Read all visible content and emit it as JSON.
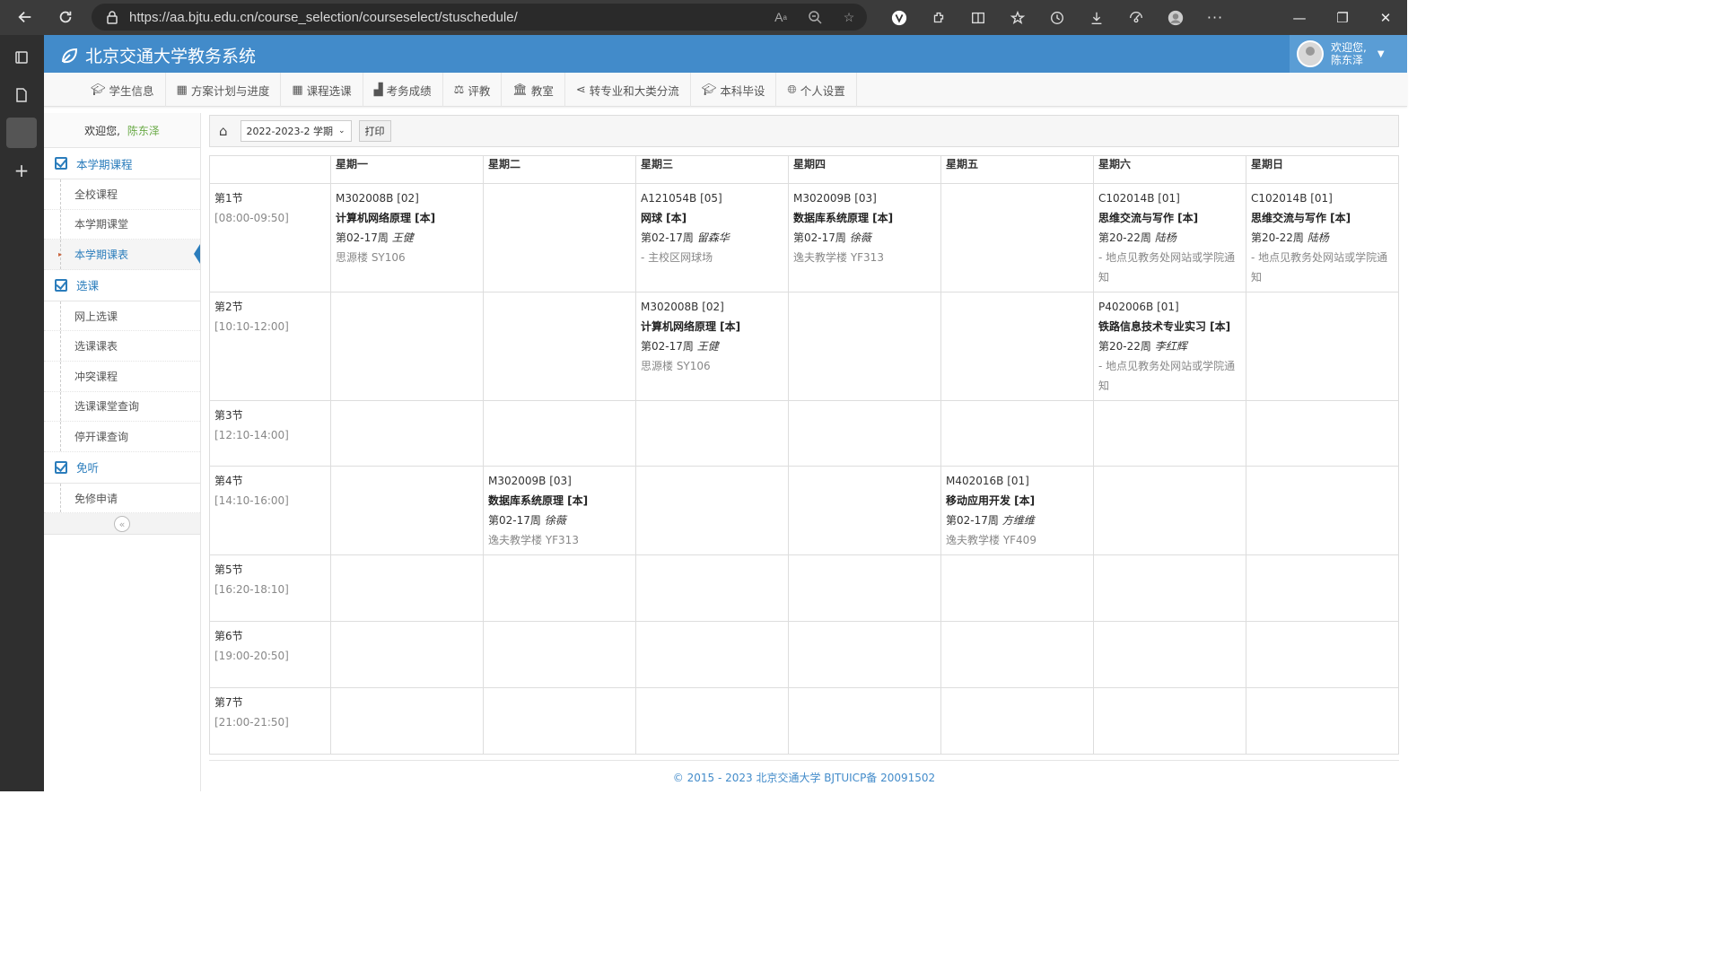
{
  "browser": {
    "url": "https://aa.bjtu.edu.cn/course_selection/courseselect/stuschedule/"
  },
  "app": {
    "title": "北京交通大学教务系统",
    "user_greeting": "欢迎您,",
    "user_name": "陈东泽"
  },
  "top_nav": [
    {
      "icon": "graduation-cap-icon",
      "label": "学生信息"
    },
    {
      "icon": "calendar-icon",
      "label": "方案计划与进度"
    },
    {
      "icon": "calendar-icon",
      "label": "课程选课"
    },
    {
      "icon": "chart-icon",
      "label": "考务成绩"
    },
    {
      "icon": "scale-icon",
      "label": "评教"
    },
    {
      "icon": "bank-icon",
      "label": "教室"
    },
    {
      "icon": "share-icon",
      "label": "转专业和大类分流"
    },
    {
      "icon": "graduation-cap-icon",
      "label": "本科毕设"
    },
    {
      "icon": "globe-icon",
      "label": "个人设置"
    }
  ],
  "sidebar": {
    "welcome": "欢迎您,",
    "user": "陈东泽",
    "groups": [
      {
        "label": "本学期课程",
        "items": [
          "全校课程",
          "本学期课堂",
          "本学期课表"
        ]
      },
      {
        "label": "选课",
        "items": [
          "网上选课",
          "选课课表",
          "冲突课程",
          "选课课堂查询",
          "停开课查询"
        ]
      },
      {
        "label": "免听",
        "items": [
          "免修申请"
        ]
      }
    ],
    "active_item": "本学期课表"
  },
  "toolbar": {
    "semester": "2022-2023-2 学期",
    "print_label": "打印"
  },
  "schedule": {
    "days": [
      "星期一",
      "星期二",
      "星期三",
      "星期四",
      "星期五",
      "星期六",
      "星期日"
    ],
    "slots": [
      {
        "name": "第1节",
        "time": "[08:00-09:50]"
      },
      {
        "name": "第2节",
        "time": "[10:10-12:00]"
      },
      {
        "name": "第3节",
        "time": "[12:10-14:00]"
      },
      {
        "name": "第4节",
        "time": "[14:10-16:00]"
      },
      {
        "name": "第5节",
        "time": "[16:20-18:10]"
      },
      {
        "name": "第6节",
        "time": "[19:00-20:50]"
      },
      {
        "name": "第7节",
        "time": "[21:00-21:50]"
      }
    ],
    "cells": {
      "0-0": {
        "code": "M302008B [02]",
        "name": "计算机网络原理 [本]",
        "weeks": "第02-17周",
        "teacher": "王健",
        "room": "思源楼 SY106"
      },
      "0-2": {
        "code": "A121054B [05]",
        "name": "网球 [本]",
        "weeks": "第02-17周",
        "teacher": "留森华",
        "room": "- 主校区网球场"
      },
      "0-3": {
        "code": "M302009B [03]",
        "name": "数据库系统原理 [本]",
        "weeks": "第02-17周",
        "teacher": "徐薇",
        "room": "逸夫教学楼 YF313"
      },
      "0-5": {
        "code": "C102014B [01]",
        "name": "思维交流与写作 [本]",
        "weeks": "第20-22周",
        "teacher": "陆杨",
        "room": "- 地点见教务处网站或学院通知"
      },
      "0-6": {
        "code": "C102014B [01]",
        "name": "思维交流与写作 [本]",
        "weeks": "第20-22周",
        "teacher": "陆杨",
        "room": "- 地点见教务处网站或学院通知"
      },
      "1-2": {
        "code": "M302008B [02]",
        "name": "计算机网络原理 [本]",
        "weeks": "第02-17周",
        "teacher": "王健",
        "room": "思源楼 SY106"
      },
      "1-5": {
        "code": "P402006B [01]",
        "name": "铁路信息技术专业实习 [本]",
        "weeks": "第20-22周",
        "teacher": "李红辉",
        "room": "- 地点见教务处网站或学院通知"
      },
      "3-1": {
        "code": "M302009B [03]",
        "name": "数据库系统原理 [本]",
        "weeks": "第02-17周",
        "teacher": "徐薇",
        "room": "逸夫教学楼 YF313"
      },
      "3-4": {
        "code": "M402016B [01]",
        "name": "移动应用开发 [本]",
        "weeks": "第02-17周",
        "teacher": "方维维",
        "room": "逸夫教学楼 YF409"
      }
    }
  },
  "footer": "© 2015 - 2023 北京交通大学 BJTUICP备 20091502",
  "colors": {
    "header": "#428bca",
    "accent": "#2b7dbc",
    "user_name": "#69aa46"
  }
}
